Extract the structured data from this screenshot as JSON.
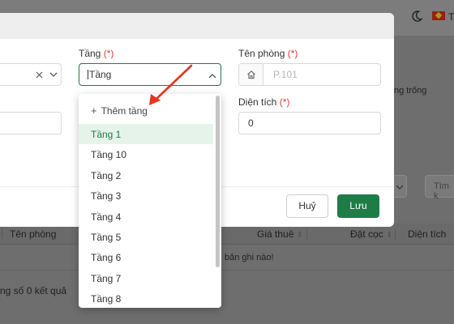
{
  "background": {
    "language_code": "T",
    "empty_label_partial": "ng trống",
    "search_placeholder_partial": "Tìm k",
    "table": {
      "columns": [
        "Tên phòng",
        "Giá thuê",
        "Đặt cọc",
        "Diện tích"
      ],
      "no_data_text": "bản ghi nào!",
      "total_text": "ng số 0 kết quả"
    }
  },
  "modal": {
    "floor_field": {
      "label": "Tầng",
      "required_mark": "(*)",
      "value": "Tầng",
      "chevron_icon": "chevron-up-icon"
    },
    "room_name_field": {
      "label": "Tên phòng",
      "required_mark": "(*)",
      "placeholder": "P.101",
      "addon_icon": "home-icon"
    },
    "area_field": {
      "label": "Diện tích",
      "required_mark": "(*)",
      "value": "0"
    },
    "left_select": {
      "clear_icon": "close-icon",
      "chevron_icon": "chevron-down-icon"
    },
    "buttons": {
      "cancel": "Huỷ",
      "save": "Lưu"
    }
  },
  "floor_dropdown": {
    "add_label": "Thêm tầng",
    "selected": "Tầng 1",
    "options": [
      "Tầng 1",
      "Tầng 10",
      "Tầng 2",
      "Tầng 3",
      "Tầng 4",
      "Tầng 5",
      "Tầng 6",
      "Tầng 7",
      "Tầng 8"
    ]
  },
  "annotation": {
    "arrow_color": "#e8341c"
  },
  "colors": {
    "accent": "#1e7d46",
    "required": "#e53935",
    "selected_bg": "#e6f3ea"
  }
}
